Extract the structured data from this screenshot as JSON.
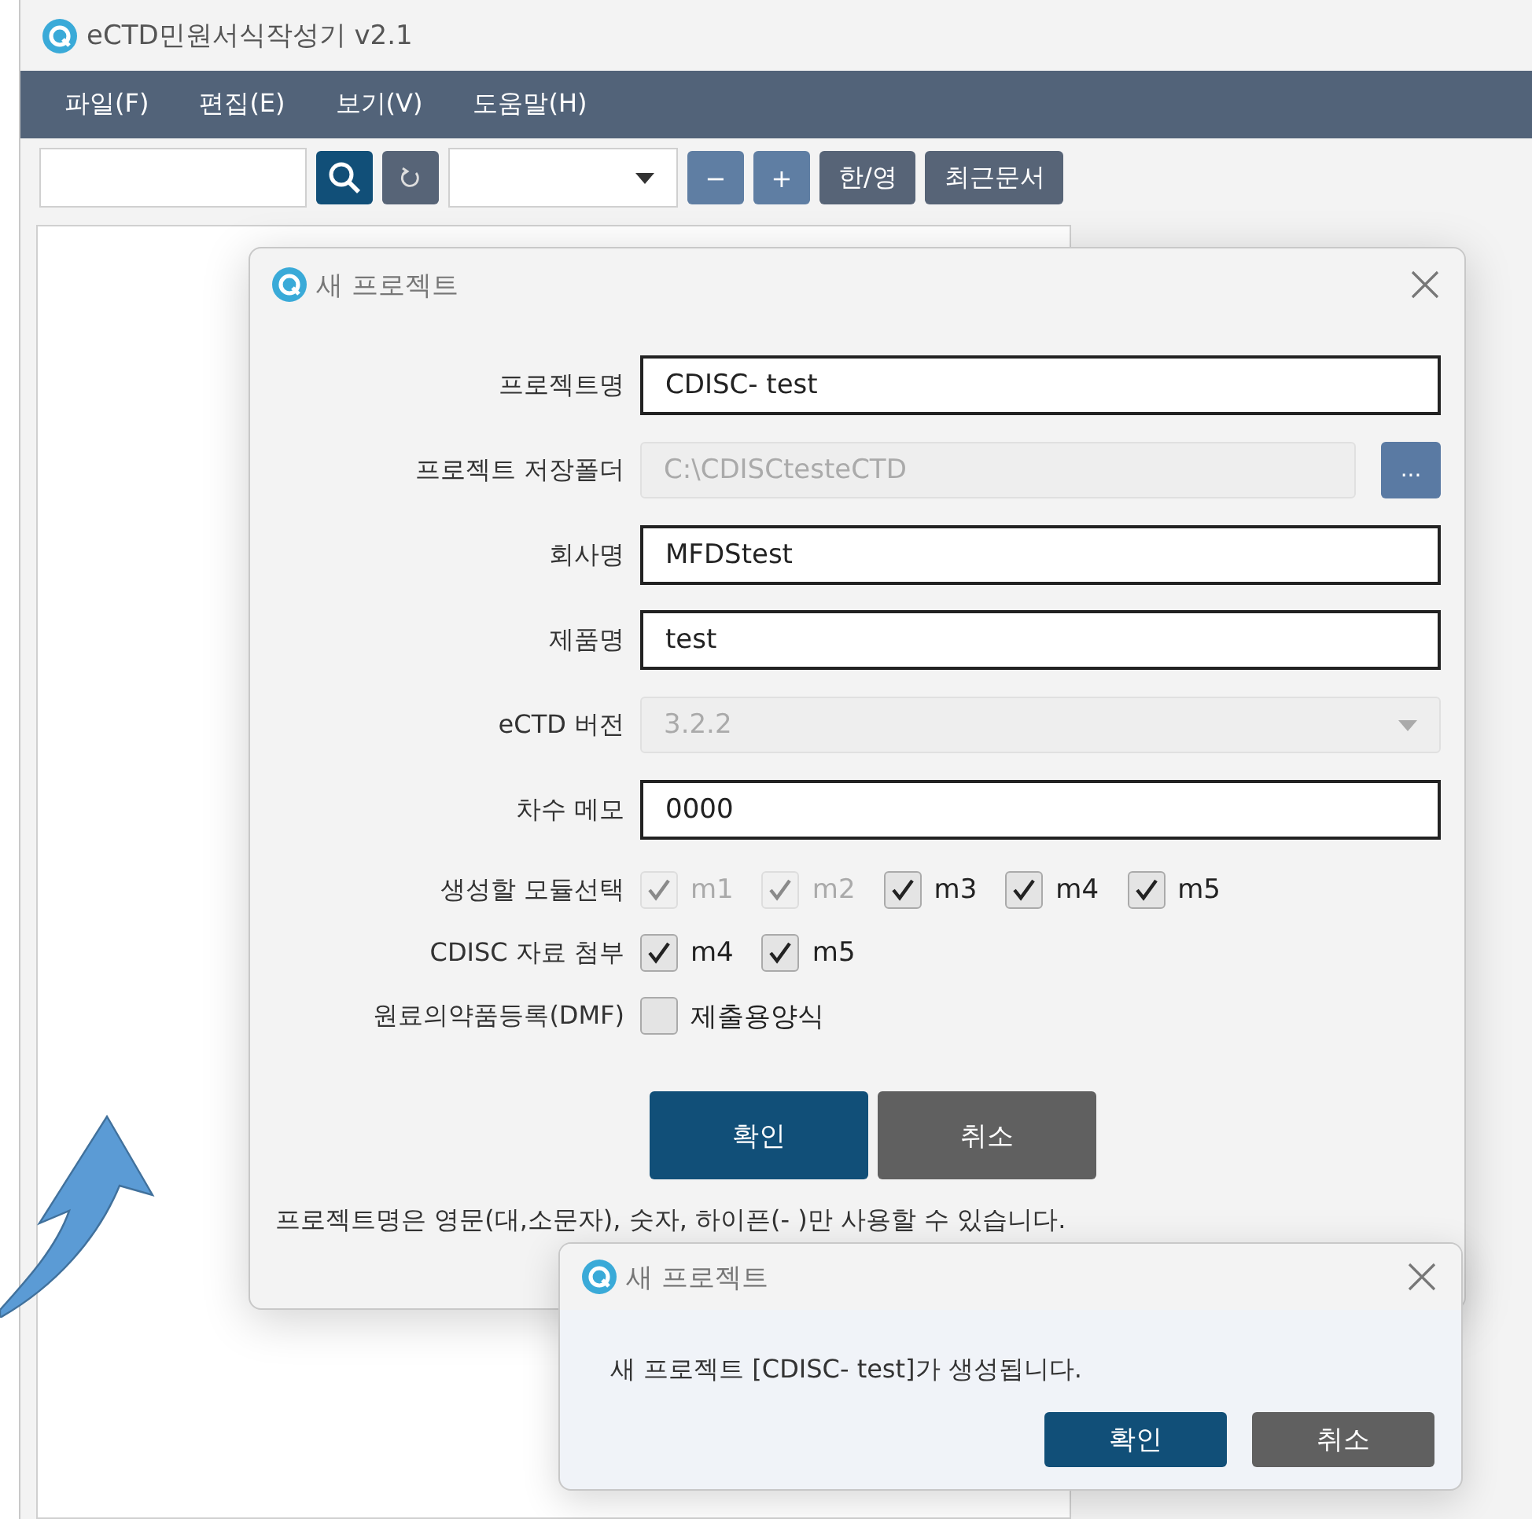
{
  "window": {
    "title": "eCTD민원서식작성기 v2.1"
  },
  "menu": [
    {
      "label": "파일(F)"
    },
    {
      "label": "편집(E)"
    },
    {
      "label": "보기(V)"
    },
    {
      "label": "도움말(H)"
    }
  ],
  "toolbar": {
    "buttons": [
      {
        "label": "−",
        "kind": "zoom"
      },
      {
        "label": "+",
        "kind": "zoom"
      },
      {
        "label": "한/영",
        "kind": "text"
      },
      {
        "label": "최근문서",
        "kind": "text"
      }
    ]
  },
  "dialog": {
    "title": "새 프로젝트",
    "fields": [
      {
        "label": "프로젝트명",
        "value": "CDISC- test",
        "kind": "text",
        "disabled": false
      },
      {
        "label": "프로젝트 저장폴더",
        "value": "C:\\CDISCtesteCTD",
        "kind": "folder",
        "disabled": true,
        "browse": "..."
      },
      {
        "label": "회사명",
        "value": "MFDStest",
        "kind": "text",
        "disabled": false
      },
      {
        "label": "제품명",
        "value": "test",
        "kind": "text",
        "disabled": false
      },
      {
        "label": "eCTD 버전",
        "value": "3.2.2",
        "kind": "select",
        "disabled": true
      },
      {
        "label": "차수 메모",
        "value": "0000",
        "kind": "text",
        "disabled": false
      }
    ],
    "checkbox_rows": [
      {
        "label": "생성할 모듈선택",
        "options": [
          {
            "label": "m1",
            "checked": true,
            "disabled": true
          },
          {
            "label": "m2",
            "checked": true,
            "disabled": true
          },
          {
            "label": "m3",
            "checked": true,
            "disabled": false
          },
          {
            "label": "m4",
            "checked": true,
            "disabled": false
          },
          {
            "label": "m5",
            "checked": true,
            "disabled": false
          }
        ]
      },
      {
        "label": "CDISC 자료 첨부",
        "options": [
          {
            "label": "m4",
            "checked": true,
            "disabled": false
          },
          {
            "label": "m5",
            "checked": true,
            "disabled": false
          }
        ]
      },
      {
        "label": "원료의약품등록(DMF)",
        "options": [
          {
            "label": "제출용양식",
            "checked": false,
            "disabled": false
          }
        ]
      }
    ],
    "buttons": [
      {
        "label": "확인",
        "kind": "primary"
      },
      {
        "label": "취소",
        "kind": "secondary"
      }
    ],
    "note": "프로젝트명은 영문(대,소문자), 숫자, 하이픈(- )만 사용할 수 있습니다."
  },
  "message_box": {
    "title": "새 프로젝트",
    "message": "새 프로젝트 [CDISC- test]가 생성됩니다.",
    "buttons": [
      {
        "label": "확인",
        "kind": "primary"
      },
      {
        "label": "취소",
        "kind": "secondary"
      }
    ]
  }
}
